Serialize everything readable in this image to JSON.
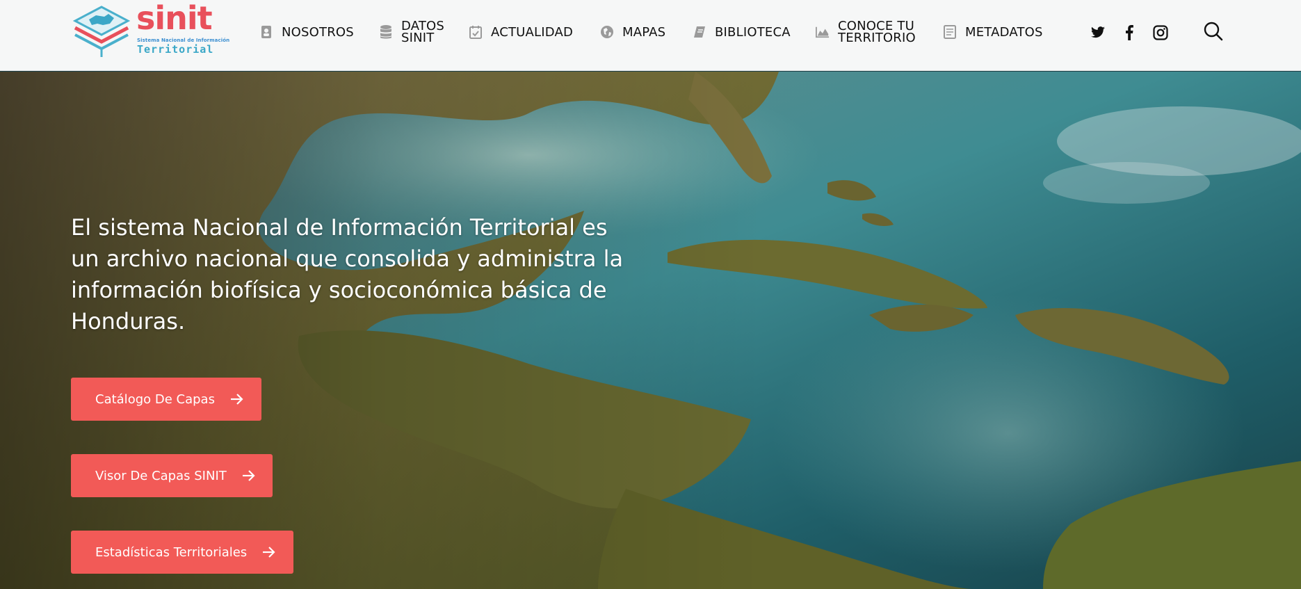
{
  "brand": {
    "word": "sinit",
    "subtitle": "Sistema Nacional de Información",
    "tagline": "Territorial"
  },
  "nav": [
    {
      "label": "NOSOTROS",
      "icon": "address-book-icon"
    },
    {
      "label": "DATOS\nSINIT",
      "icon": "database-icon"
    },
    {
      "label": "ACTUALIDAD",
      "icon": "calendar-check-icon"
    },
    {
      "label": "MAPAS",
      "icon": "globe-icon"
    },
    {
      "label": "BIBLIOTECA",
      "icon": "book-icon"
    },
    {
      "label": "CONOCE TU\nTERRITORIO",
      "icon": "area-chart-icon"
    },
    {
      "label": "METADATOS",
      "icon": "document-list-icon"
    }
  ],
  "social": [
    "twitter-icon",
    "facebook-icon",
    "instagram-icon"
  ],
  "hero": {
    "headline": "El sistema Nacional de Información Territorial es un archivo nacional que consolida y administra la información biofísica y socioconómica básica de Honduras.",
    "buttons": [
      {
        "label": "Catálogo De Capas"
      },
      {
        "label": "Visor De Capas SINIT"
      },
      {
        "label": "Estadísticas Territoriales"
      }
    ]
  },
  "colors": {
    "accent": "#f25a57",
    "logo_red": "#e8505b",
    "logo_blue": "#3aa7c7",
    "header_bg": "#f6f7f7"
  }
}
